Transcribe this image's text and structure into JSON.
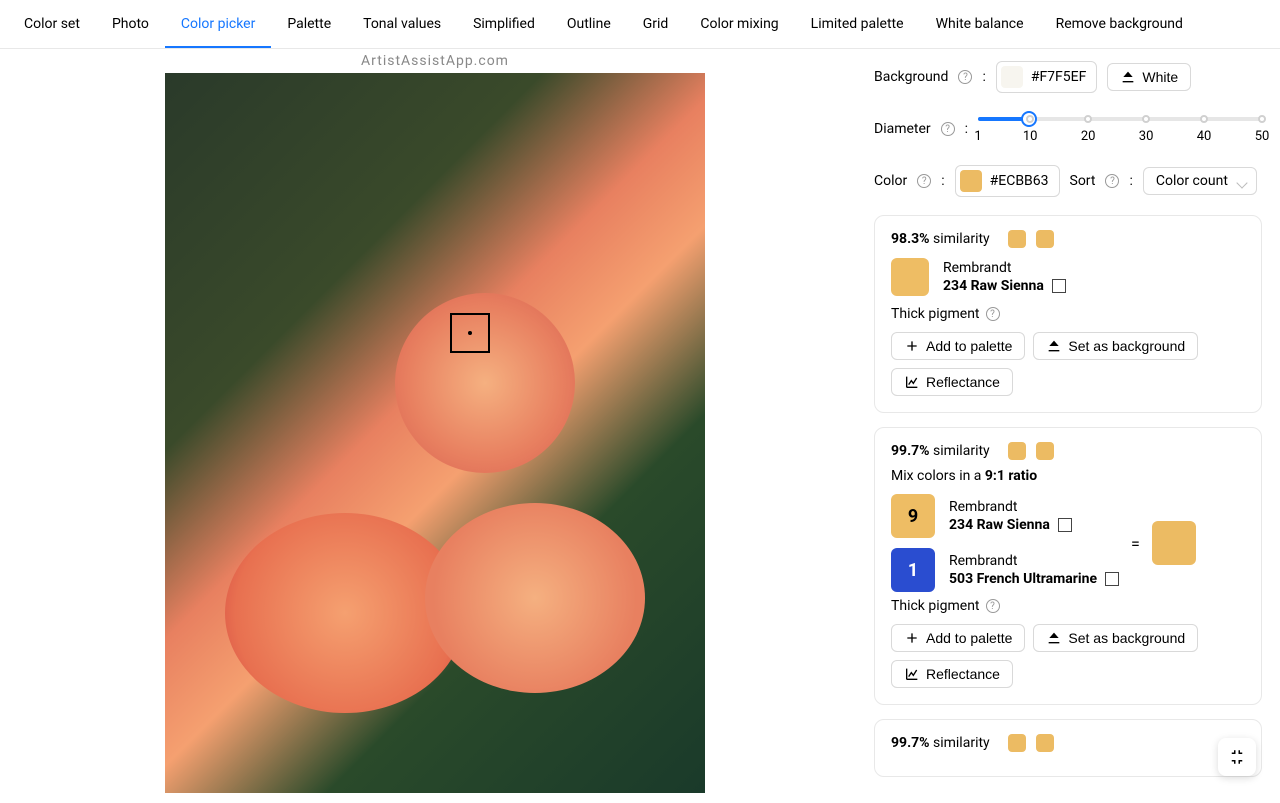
{
  "watermark": "ArtistAssistApp.com",
  "tabs": [
    {
      "label": "Color set"
    },
    {
      "label": "Photo"
    },
    {
      "label": "Color picker",
      "active": true
    },
    {
      "label": "Palette"
    },
    {
      "label": "Tonal values"
    },
    {
      "label": "Simplified"
    },
    {
      "label": "Outline"
    },
    {
      "label": "Grid"
    },
    {
      "label": "Color mixing"
    },
    {
      "label": "Limited palette"
    },
    {
      "label": "White balance"
    },
    {
      "label": "Remove background"
    }
  ],
  "controls": {
    "background_label": "Background",
    "background_hex": "#F7F5EF",
    "white_btn": "White",
    "diameter_label": "Diameter",
    "diameter_value": 10,
    "diameter_marks": [
      1,
      10,
      20,
      30,
      40,
      50
    ],
    "color_label": "Color",
    "color_hex": "#ECBB63",
    "sort_label": "Sort",
    "sort_value": "Color count"
  },
  "common": {
    "similarity_word": "similarity",
    "thick_pigment": "Thick pigment",
    "add_palette": "Add to palette",
    "set_background": "Set as background",
    "reflectance": "Reflectance",
    "mix_prefix": "Mix colors in a ",
    "ratio_suffix": " ratio",
    "equals": "="
  },
  "cards": [
    {
      "similarity": "98.3%",
      "swatch1": "#ecbb63",
      "swatch2": "#ecbb63",
      "paints": [
        {
          "brand": "Rembrandt",
          "name": "234 Raw Sienna",
          "color": "#eebd64"
        }
      ],
      "thick": true
    },
    {
      "similarity": "99.7%",
      "swatch1": "#ecbb63",
      "swatch2": "#ecbb63",
      "mix_ratio": "9:1",
      "paints": [
        {
          "ratio": "9",
          "ratio_bg": "#eebd64",
          "ratio_fg": "#000",
          "brand": "Rembrandt",
          "name": "234 Raw Sienna"
        },
        {
          "ratio": "1",
          "ratio_bg": "#2a4dd0",
          "ratio_fg": "#fff",
          "brand": "Rembrandt",
          "name": "503 French Ultramarine"
        }
      ],
      "result_color": "#ecbb63",
      "thick": true
    },
    {
      "similarity": "99.7%",
      "swatch1": "#ecbb63",
      "swatch2": "#ecbb63"
    }
  ]
}
